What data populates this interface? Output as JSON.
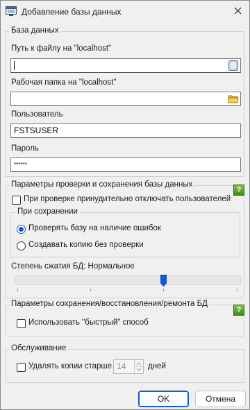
{
  "window": {
    "title": "Добавление базы данных"
  },
  "db_group": {
    "legend": "База данных",
    "path_label": "Путь к файлу на \"localhost\"",
    "path_value": "",
    "workdir_label": "Рабочая папка на \"localhost\"",
    "workdir_value": "",
    "user_label": "Пользователь",
    "user_value": "FSTSUSER",
    "password_label": "Пароль",
    "password_value": "******"
  },
  "check_group": {
    "legend": "Параметры проверки и сохранения базы данных",
    "help": "?",
    "force_disconnect_label": "При проверке принудительно отключать пользователей",
    "force_disconnect_checked": false,
    "on_save_legend": "При сохранении",
    "options": [
      {
        "label": "Проверять базу  на наличие ошибок",
        "selected": true
      },
      {
        "label": "Создавать копию без проверки",
        "selected": false
      }
    ],
    "compression_label": "Степень сжатия БД: Нормальное",
    "compression_level_fraction": 0.66
  },
  "restore_group": {
    "legend": "Параметры сохранения/восстановления/ремонта БД",
    "help": "?",
    "fast_label": "Использовать \"быстрый\" способ",
    "fast_checked": false
  },
  "maint_group": {
    "legend": "Обслуживание",
    "delete_label": "Удалять копии старше",
    "delete_checked": false,
    "days_value": "14",
    "days_unit": "дней"
  },
  "buttons": {
    "ok": "OK",
    "cancel": "Отмена"
  },
  "colors": {
    "accent": "#0a5cd6",
    "help_green": "#4f9a25"
  },
  "icons": {
    "app": "database-window-icon",
    "close": "close-icon",
    "path_browse": "file-browse-icon",
    "folder_browse": "folder-icon",
    "help": "help-icon"
  }
}
